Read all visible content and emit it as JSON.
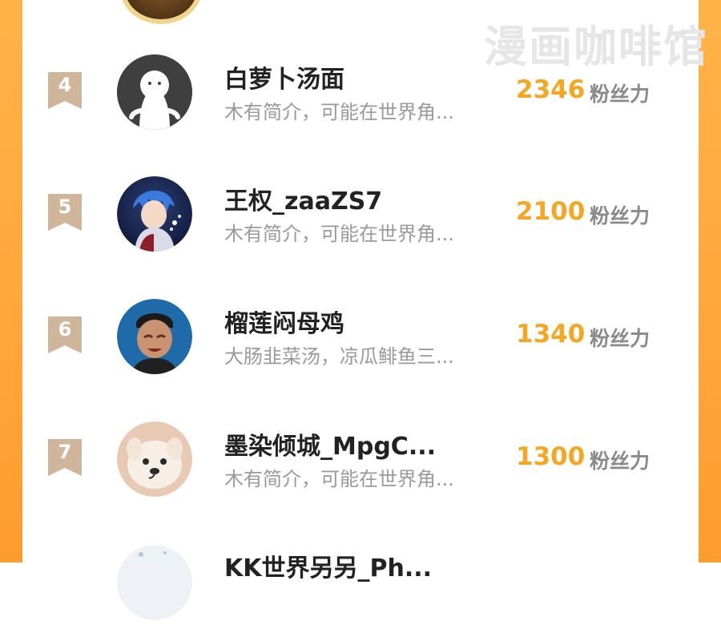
{
  "watermark": "漫画咖啡馆",
  "score_unit": "粉丝力",
  "colors": {
    "side_orange": "#ffa63a",
    "score_orange": "#f5a623",
    "rank_badge": "#cfb59a",
    "name_text": "#222222",
    "bio_text": "#9a9a9a"
  },
  "rows": [
    {
      "rank": "4",
      "name": "白萝卜汤面",
      "bio": "木有简介，可能在世界角...",
      "score": "2346",
      "avatar_icon": "default-ghost-avatar-icon"
    },
    {
      "rank": "5",
      "name": "王权_zaaZS7",
      "bio": "木有简介，可能在世界角...",
      "score": "2100",
      "avatar_icon": "anime-boy-avatar"
    },
    {
      "rank": "6",
      "name": "榴莲闷母鸡",
      "bio": "大肠韭菜汤，凉瓜鲱鱼三...",
      "score": "1340",
      "avatar_icon": "crying-man-avatar"
    },
    {
      "rank": "7",
      "name": "墨染倾城_MpgC...",
      "bio": "木有简介，可能在世界角...",
      "score": "1300",
      "avatar_icon": "puppy-avatar"
    },
    {
      "rank": "",
      "name": "KK世界另另_Ph...",
      "bio": "",
      "score": "",
      "avatar_icon": "snow-avatar"
    }
  ]
}
